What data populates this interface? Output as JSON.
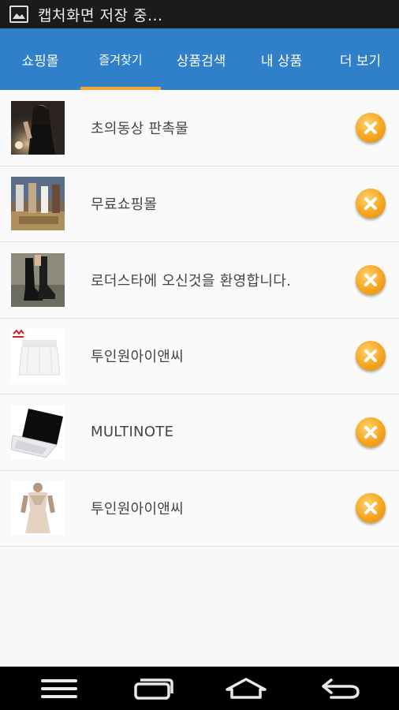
{
  "status_bar": {
    "notification_text": "캡처화면 저장 중...",
    "icon": "gallery-icon"
  },
  "tabs": [
    {
      "label": "쇼핑몰",
      "active": false
    },
    {
      "label": "즐겨찾기",
      "active": true
    },
    {
      "label": "상품검색",
      "active": false
    },
    {
      "label": "내 상품",
      "active": false
    },
    {
      "label": "더 보기",
      "active": false
    }
  ],
  "favorites": [
    {
      "name": "초의동상 판촉물",
      "thumb": "woman-in-black-dress-photo"
    },
    {
      "name": "무료쇼핑몰",
      "thumb": "clothing-store-display-photo"
    },
    {
      "name": "로더스타에 오신것을 환영합니다.",
      "thumb": "black-boots-photo"
    },
    {
      "name": "투인원아이앤씨",
      "thumb": "white-tennis-skirt-photo"
    },
    {
      "name": "MULTINOTE",
      "thumb": "black-laptop-photo"
    },
    {
      "name": "투인원아이앤씨",
      "thumb": "beige-dress-photo"
    }
  ],
  "delete_icon": "close-circle-icon",
  "colors": {
    "tab_bar": "#2f7fc9",
    "tab_indicator": "#f0a431",
    "delete_button": "#f6a51f",
    "status_bar": "#1b1b1b",
    "nav_bar": "#000000"
  },
  "nav_bar": {
    "buttons": [
      "menu-icon",
      "recent-apps-icon",
      "home-icon",
      "back-icon"
    ]
  }
}
